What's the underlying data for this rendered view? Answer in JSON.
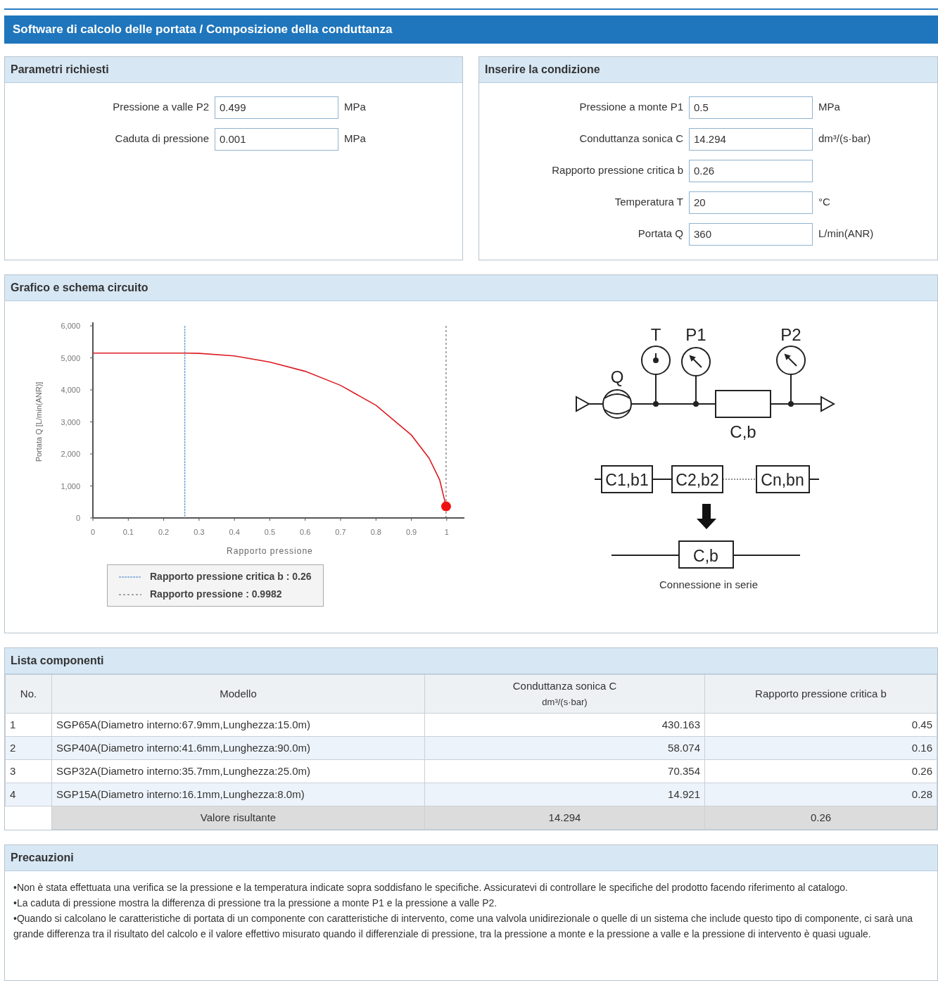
{
  "title": "Software di calcolo delle portata / Composizione della conduttanza",
  "required_params": {
    "heading": "Parametri richiesti",
    "fields": [
      {
        "label": "Pressione a valle P2",
        "value": "0.499",
        "unit": "MPa"
      },
      {
        "label": "Caduta di pressione",
        "value": "0.001",
        "unit": "MPa"
      }
    ]
  },
  "conditions": {
    "heading": "Inserire la condizione",
    "fields": [
      {
        "label": "Pressione a monte P1",
        "value": "0.5",
        "unit": "MPa"
      },
      {
        "label": "Conduttanza sonica C",
        "value": "14.294",
        "unit": "dm³/(s·bar)"
      },
      {
        "label": "Rapporto pressione critica b",
        "value": "0.26"
      },
      {
        "label": "Temperatura T",
        "value": "20",
        "unit": "°C"
      },
      {
        "label": "Portata Q",
        "value": "360",
        "unit": "L/min(ANR)"
      }
    ]
  },
  "graph": {
    "heading": "Grafico e schema circuito",
    "chart_data": {
      "type": "line",
      "xlabel": "Rapporto pressione",
      "ylabel": "Portata Q [L/min(ANR)]",
      "x": [
        0,
        0.1,
        0.2,
        0.26,
        0.3,
        0.4,
        0.5,
        0.6,
        0.7,
        0.8,
        0.9,
        0.95,
        0.98,
        0.9982
      ],
      "series": [
        {
          "color": "#dd1c24",
          "values": [
            5150,
            5150,
            5150,
            5150,
            5140,
            5060,
            4870,
            4580,
            4140,
            3520,
            2590,
            1870,
            1190,
            360
          ]
        },
        {
          "color": "#ee1111",
          "marker": "circle",
          "values": [
            null,
            null,
            null,
            null,
            null,
            null,
            null,
            null,
            null,
            null,
            null,
            null,
            null,
            360
          ]
        }
      ],
      "xlim": [
        0,
        1.05
      ],
      "legend": "below",
      "ylim": [
        0,
        6000
      ],
      "xticks": [
        0,
        0.1,
        0.2,
        0.3,
        0.4,
        0.5,
        0.6,
        0.7,
        0.8,
        0.9,
        1
      ],
      "yticks": [
        0,
        {
          "value": 1000,
          "label": "1,000"
        },
        {
          "value": 2000,
          "label": "2,000"
        },
        {
          "value": 3000,
          "label": "3,000"
        },
        {
          "value": 4000,
          "label": "4,000"
        },
        {
          "value": 5000,
          "label": "5,000"
        },
        {
          "value": 6000,
          "label": "6,000"
        }
      ],
      "ref_lines": [
        {
          "axis": "x",
          "value": 0.26,
          "color": "#3a7fc4",
          "label": "Rapporto pressione critica b : 0.26"
        },
        {
          "axis": "x",
          "value": 0.9982,
          "color": "#555555",
          "label": "Rapporto pressione : 0.9982"
        }
      ]
    },
    "circuit": {
      "flow_label": "Q",
      "gauges": [
        {
          "label": "T",
          "kind": "temperature"
        },
        {
          "label": "P1",
          "kind": "pressure"
        },
        {
          "label": "P2",
          "kind": "pressure"
        }
      ],
      "element_label": "C,b",
      "series_blocks": [
        "C1,b1",
        "C2,b2",
        "Cn,bn"
      ],
      "result_block": "C,b",
      "caption": "Connessione in serie"
    }
  },
  "components": {
    "heading": "Lista componenti",
    "columns": [
      "No.",
      "Modello",
      [
        "Conduttanza sonica C",
        "dm³/(s·bar)"
      ],
      "Rapporto pressione critica b"
    ],
    "rows": [
      {
        "no": "1",
        "model": "SGP65A(Diametro interno:67.9mm,Lunghezza:15.0m)",
        "c": "430.163",
        "b": "0.45"
      },
      {
        "no": "2",
        "model": "SGP40A(Diametro interno:41.6mm,Lunghezza:90.0m)",
        "c": "58.074",
        "b": "0.16"
      },
      {
        "no": "3",
        "model": "SGP32A(Diametro interno:35.7mm,Lunghezza:25.0m)",
        "c": "70.354",
        "b": "0.26"
      },
      {
        "no": "4",
        "model": "SGP15A(Diametro interno:16.1mm,Lunghezza:8.0m)",
        "c": "14.921",
        "b": "0.28"
      }
    ],
    "total": {
      "label": "Valore risultante",
      "c": "14.294",
      "b": "0.26"
    }
  },
  "precautions": {
    "heading": "Precauzioni",
    "items": [
      "•Non è stata effettuata una verifica se la pressione e la temperatura indicate sopra soddisfano le specifiche. Assicuratevi di controllare le specifiche del prodotto facendo riferimento al catalogo.",
      "•La caduta di pressione mostra la differenza di pressione tra la pressione a monte P1 e la pressione a valle P2.",
      "•Quando si calcolano le caratteristiche di portata di un componente con caratteristiche di intervento, come una valvola unidirezionale o quelle di un sistema che include questo tipo di componente, ci sarà una grande differenza tra il risultato del calcolo e il valore effettivo misurato quando il differenziale di pressione, tra la pressione a monte e la pressione a valle e la pressione di intervento è quasi uguale."
    ]
  }
}
